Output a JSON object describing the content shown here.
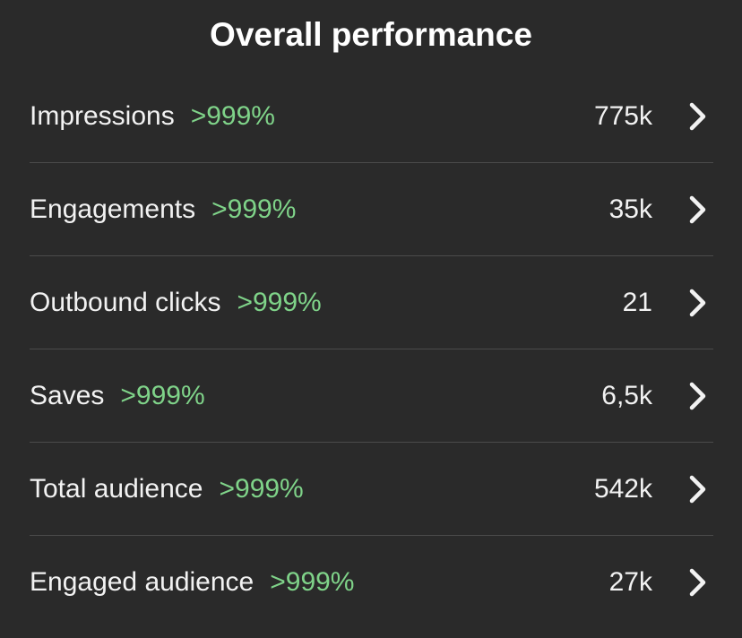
{
  "header": {
    "title": "Overall performance"
  },
  "colors": {
    "background": "#2a2a2a",
    "text": "#f2f2f2",
    "positive_change": "#7fd389",
    "divider": "#4b4b4b"
  },
  "metrics": [
    {
      "label": "Impressions",
      "change": ">999%",
      "value": "775k",
      "icon": "chevron-right-icon"
    },
    {
      "label": "Engagements",
      "change": ">999%",
      "value": "35k",
      "icon": "chevron-right-icon"
    },
    {
      "label": "Outbound clicks",
      "change": ">999%",
      "value": "21",
      "icon": "chevron-right-icon"
    },
    {
      "label": "Saves",
      "change": ">999%",
      "value": "6,5k",
      "icon": "chevron-right-icon"
    },
    {
      "label": "Total audience",
      "change": ">999%",
      "value": "542k",
      "icon": "chevron-right-icon"
    },
    {
      "label": "Engaged audience",
      "change": ">999%",
      "value": "27k",
      "icon": "chevron-right-icon"
    }
  ]
}
